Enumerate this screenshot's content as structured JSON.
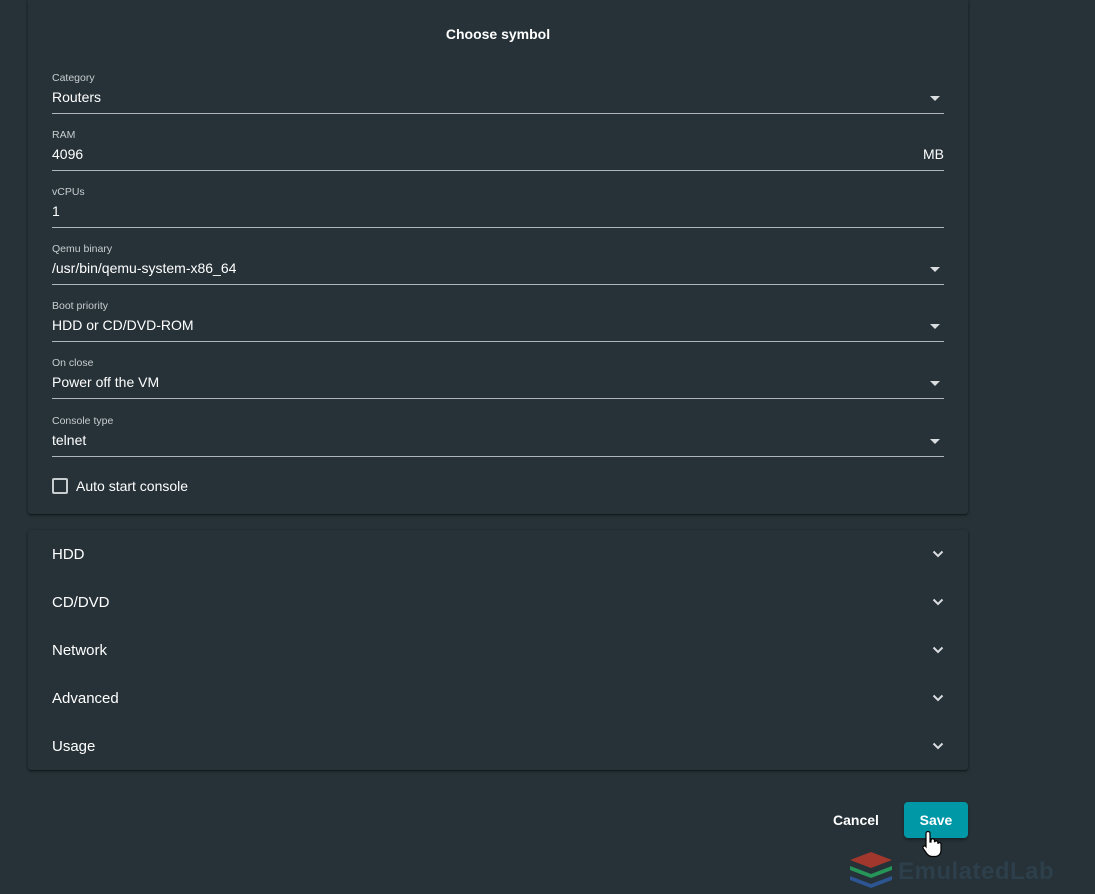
{
  "dialog": {
    "choose_symbol": "Choose symbol"
  },
  "fields": {
    "category": {
      "label": "Category",
      "value": "Routers"
    },
    "ram": {
      "label": "RAM",
      "value": "4096",
      "suffix": "MB"
    },
    "vcpus": {
      "label": "vCPUs",
      "value": "1"
    },
    "qemu_binary": {
      "label": "Qemu binary",
      "value": "/usr/bin/qemu-system-x86_64"
    },
    "boot_priority": {
      "label": "Boot priority",
      "value": "HDD or CD/DVD-ROM"
    },
    "on_close": {
      "label": "On close",
      "value": "Power off the VM"
    },
    "console_type": {
      "label": "Console type",
      "value": "telnet"
    }
  },
  "auto_start_console": {
    "label": "Auto start console",
    "checked": false
  },
  "panels": [
    {
      "title": "HDD"
    },
    {
      "title": "CD/DVD"
    },
    {
      "title": "Network"
    },
    {
      "title": "Advanced"
    },
    {
      "title": "Usage"
    }
  ],
  "actions": {
    "cancel_label": "Cancel",
    "save_label": "Save"
  },
  "watermark": {
    "text": "EmulatedLab"
  },
  "colors": {
    "background": "#263238",
    "accent": "#0097a7",
    "text": "#ffffff",
    "label": "#c8cdd0",
    "divider": "#b0b6b9"
  },
  "icons": {
    "dropdown": "dropdown-arrow-icon",
    "expand": "chevron-down-icon",
    "checkbox": "checkbox-unchecked-icon",
    "cursor": "hand-pointer-icon"
  }
}
